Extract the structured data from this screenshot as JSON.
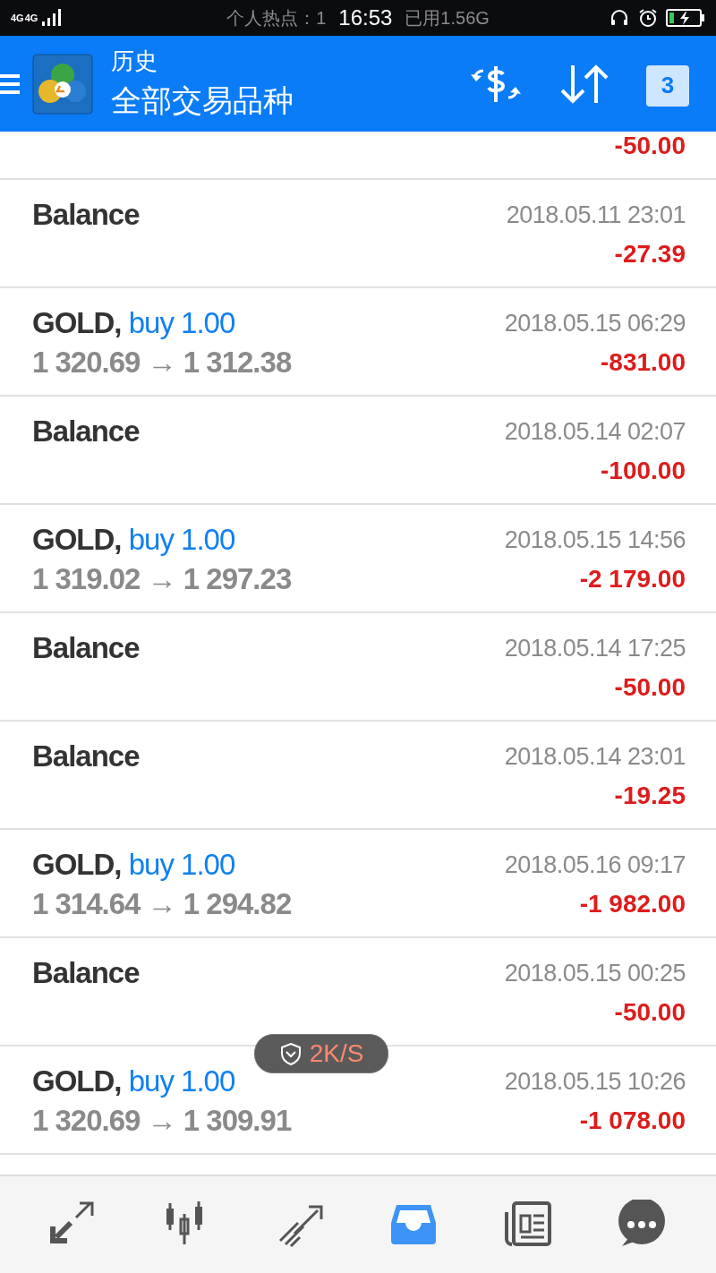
{
  "status_bar": {
    "network": "4G",
    "network_2": "4G",
    "notice_left": "个人热点：1",
    "time": "16:53",
    "notice_right": "已用1.56G"
  },
  "header": {
    "title": "历史",
    "subtitle": "全部交易品种",
    "calendar_day": "3"
  },
  "rows": [
    {
      "kind": "cut",
      "profit": "-50.00"
    },
    {
      "kind": "balance",
      "title": "Balance",
      "time": "2018.05.11 23:01",
      "profit": "-27.39"
    },
    {
      "kind": "trade",
      "symbol": "GOLD,",
      "side": "buy 1.00",
      "prices": "1 320.69 → 1 312.38",
      "time": "2018.05.15 06:29",
      "profit": "-831.00"
    },
    {
      "kind": "balance",
      "title": "Balance",
      "time": "2018.05.14 02:07",
      "profit": "-100.00"
    },
    {
      "kind": "trade",
      "symbol": "GOLD,",
      "side": "buy 1.00",
      "prices": "1 319.02 → 1 297.23",
      "time": "2018.05.15 14:56",
      "profit": "-2 179.00"
    },
    {
      "kind": "balance",
      "title": "Balance",
      "time": "2018.05.14 17:25",
      "profit": "-50.00"
    },
    {
      "kind": "balance",
      "title": "Balance",
      "time": "2018.05.14 23:01",
      "profit": "-19.25"
    },
    {
      "kind": "trade",
      "symbol": "GOLD,",
      "side": "buy 1.00",
      "prices": "1 314.64 → 1 294.82",
      "time": "2018.05.16 09:17",
      "profit": "-1 982.00"
    },
    {
      "kind": "balance",
      "title": "Balance",
      "time": "2018.05.15 00:25",
      "profit": "-50.00"
    },
    {
      "kind": "trade",
      "symbol": "GOLD,",
      "side": "buy 1.00",
      "prices": "1 320.69 → 1 309.91",
      "time": "2018.05.15 10:26",
      "profit": "-1 078.00"
    }
  ],
  "speed_badge": "2K/S",
  "nav_tabs": [
    {
      "kind": "quotes",
      "selected": false
    },
    {
      "kind": "chart",
      "selected": false
    },
    {
      "kind": "trade",
      "selected": false
    },
    {
      "kind": "history",
      "selected": true
    },
    {
      "kind": "news",
      "selected": false
    },
    {
      "kind": "chat",
      "selected": false
    }
  ]
}
